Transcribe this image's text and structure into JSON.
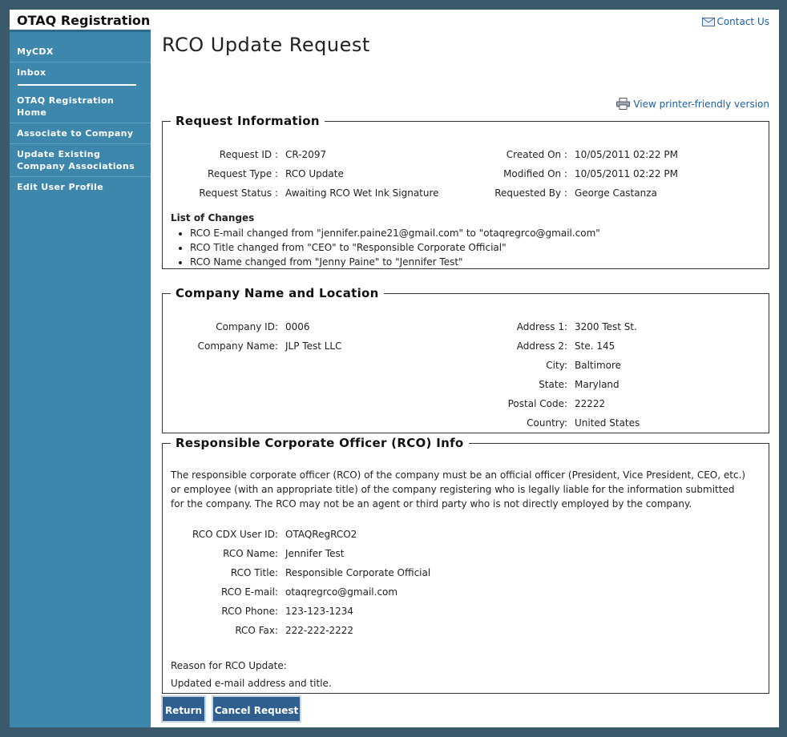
{
  "app": {
    "title": "OTAQ Registration"
  },
  "sidebar": {
    "items": [
      {
        "label": "MyCDX"
      },
      {
        "label": "Inbox"
      },
      {
        "label": "OTAQ Registration Home"
      },
      {
        "label": "Associate to Company"
      },
      {
        "label": "Update Existing Company Associations"
      },
      {
        "label": "Edit User Profile"
      }
    ]
  },
  "header": {
    "contact_label": "Contact Us",
    "page_title": "RCO Update Request",
    "printer_label": "View printer-friendly version"
  },
  "request": {
    "legend": "Request Information",
    "id_label": "Request ID :",
    "id": "CR-2097",
    "type_label": "Request Type :",
    "type": "RCO Update",
    "status_label": "Request Status :",
    "status": "Awaiting RCO Wet Ink Signature",
    "created_label": "Created On :",
    "created": "10/05/2011 02:22 PM",
    "modified_label": "Modified On :",
    "modified": "10/05/2011 02:22 PM",
    "requested_label": "Requested By :",
    "requested_by": "George Castanza",
    "changes_title": "List of Changes",
    "changes": [
      "RCO E-mail changed from \"jennifer.paine21@gmail.com\" to \"otaqregrco@gmail.com\"",
      "RCO Title changed from \"CEO\" to \"Responsible Corporate Official\"",
      "RCO Name changed from \"Jenny Paine\" to \"Jennifer Test\""
    ]
  },
  "company": {
    "legend": "Company Name and Location",
    "id_label": "Company ID:",
    "id": "0006",
    "name_label": "Company Name:",
    "name": "JLP Test LLC",
    "addr1_label": "Address 1:",
    "addr1": "3200 Test St.",
    "addr2_label": "Address 2:",
    "addr2": "Ste. 145",
    "city_label": "City:",
    "city": "Baltimore",
    "state_label": "State:",
    "state": "Maryland",
    "postal_label": "Postal Code:",
    "postal": "22222",
    "country_label": "Country:",
    "country": "United States"
  },
  "rco": {
    "legend": "Responsible Corporate Officer (RCO) Info",
    "description": "The responsible corporate officer (RCO) of the company must be an official officer (President, Vice President, CEO, etc.) or employee (with an appropriate title) of the company registering who is legally liable for the information submitted for the company. The RCO may not be an agent or third party who is not directly employed by the company.",
    "userid_label": "RCO CDX User ID:",
    "userid": "OTAQRegRCO2",
    "name_label": "RCO Name:",
    "name": "Jennifer Test",
    "title_label": "RCO Title:",
    "title": "Responsible Corporate Official",
    "email_label": "RCO E-mail:",
    "email": "otaqregrco@gmail.com",
    "phone_label": "RCO Phone:",
    "phone": "123-123-1234",
    "fax_label": "RCO Fax:",
    "fax": "222-222-2222",
    "reason_label": "Reason for RCO Update:",
    "reason": "Updated e-mail address and title."
  },
  "actions": {
    "return_label": "Return",
    "cancel_label": "Cancel Request"
  },
  "colors": {
    "sidebar": "#3d87ad",
    "button": "#2f5f8e",
    "link": "#1f5f9a",
    "outer": "#3a5a6c"
  },
  "icons": {
    "contact": "envelope-icon",
    "printer": "printer-icon"
  }
}
